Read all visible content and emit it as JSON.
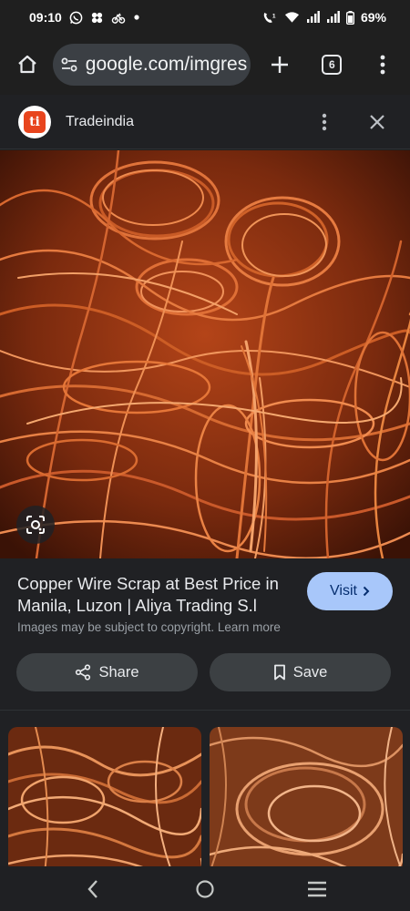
{
  "status_bar": {
    "time": "09:10",
    "battery": "69%",
    "notification_icons": [
      "whatsapp-icon",
      "pinwheel-icon",
      "bike-icon",
      "dot-icon"
    ],
    "system_icons": [
      "wifi-calling-icon",
      "wifi-icon",
      "signal-icon",
      "signal-icon",
      "battery-icon"
    ]
  },
  "browser": {
    "url": "google.com/imgres",
    "tab_count": "6"
  },
  "sheet": {
    "site_logo_text": "ti",
    "site_name": "Tradeindia"
  },
  "result": {
    "title": "Copper Wire Scrap at Best Price in Manila, Luzon | Aliya Trading S.l",
    "visit_label": "Visit",
    "copyright_text": "Images may be subject to copyright.",
    "learn_more_label": "Learn more",
    "share_label": "Share",
    "save_label": "Save"
  },
  "colors": {
    "background": "#1f1f1f",
    "sheet": "#202124",
    "visit_button": "#a8c7fa",
    "action_button": "#3c4043",
    "copper": "#d9622b"
  }
}
